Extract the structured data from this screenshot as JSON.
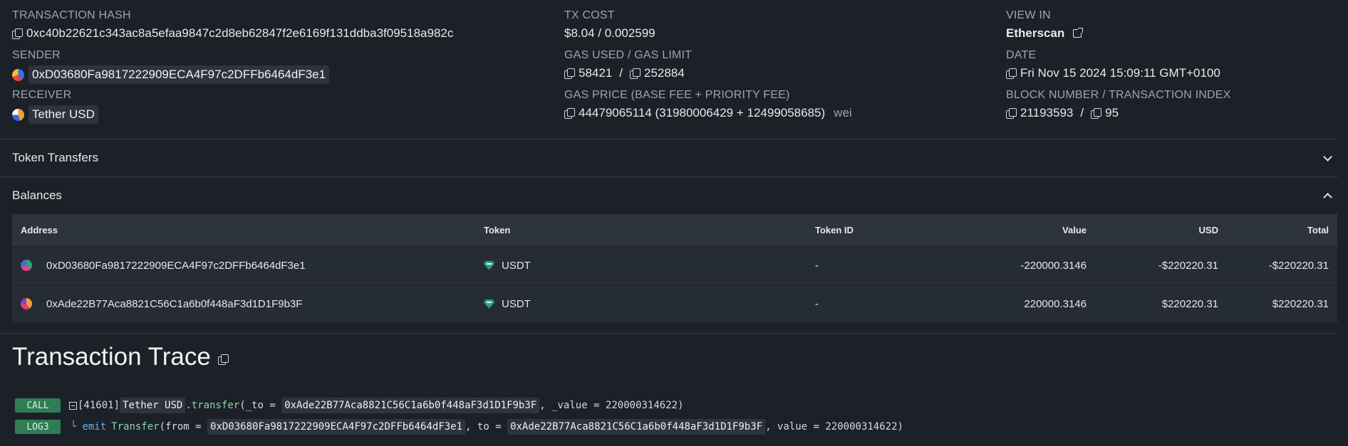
{
  "overview": {
    "tx_hash_label": "TRANSACTION HASH",
    "tx_hash": "0xc40b22621c343ac8a5efaa9847c2d8eb62847f2e6169f131ddba3f09518a982c",
    "sender_label": "SENDER",
    "sender": "0xD03680Fa9817222909ECA4F97c2DFFb6464dF3e1",
    "receiver_label": "RECEIVER",
    "receiver": "Tether USD",
    "tx_cost_label": "TX COST",
    "tx_cost": "$8.04 / 0.002599",
    "gas_label": "GAS USED / GAS LIMIT",
    "gas_used": "58421",
    "gas_sep": "/",
    "gas_limit": "252884",
    "gas_price_label": "GAS PRICE (BASE FEE + PRIORITY FEE)",
    "gas_price": "44479065114 (31980006429 + 12499058685)",
    "gas_price_unit": "wei",
    "view_in_label": "VIEW IN",
    "view_in": "Etherscan",
    "date_label": "DATE",
    "date": "Fri Nov 15 2024 15:09:11 GMT+0100",
    "block_label": "BLOCK NUMBER / TRANSACTION INDEX",
    "block_number": "21193593",
    "block_sep": "/",
    "tx_index": "95"
  },
  "sections": {
    "token_transfers": "Token Transfers",
    "balances": "Balances"
  },
  "balances": {
    "headers": [
      "Address",
      "Token",
      "Token ID",
      "Value",
      "USD",
      "Total"
    ],
    "rows": [
      {
        "address": "0xD03680Fa9817222909ECA4F97c2DFFb6464dF3e1",
        "token": "USDT",
        "token_id": "-",
        "value": "-220000.3146",
        "usd": "-$220220.31",
        "total": "-$220220.31"
      },
      {
        "address": "0xAde22B77Aca8821C56C1a6b0f448aF3d1D1F9b3F",
        "token": "USDT",
        "token_id": "-",
        "value": "220000.3146",
        "usd": "$220220.31",
        "total": "$220220.31"
      }
    ]
  },
  "trace": {
    "title": "Transaction Trace",
    "call": {
      "badge": "CALL",
      "gas": "[41601]",
      "contract": "Tether USD",
      "dot": ".",
      "method": "transfer",
      "p1": "(_to = ",
      "to": "0xAde22B77Aca8821C56C1a6b0f448aF3d1D1F9b3F",
      "p2": ", _value = 220000314622)"
    },
    "log": {
      "badge": "LOG3",
      "tree": "└",
      "emit": "emit",
      "event": "Transfer",
      "p1": "(from = ",
      "from": "0xD03680Fa9817222909ECA4F97c2DFFb6464dF3e1",
      "p2": ", to = ",
      "to": "0xAde22B77Aca8821C56C1a6b0f448aF3d1D1F9b3F",
      "p3": ", value = 220000314622)"
    }
  }
}
